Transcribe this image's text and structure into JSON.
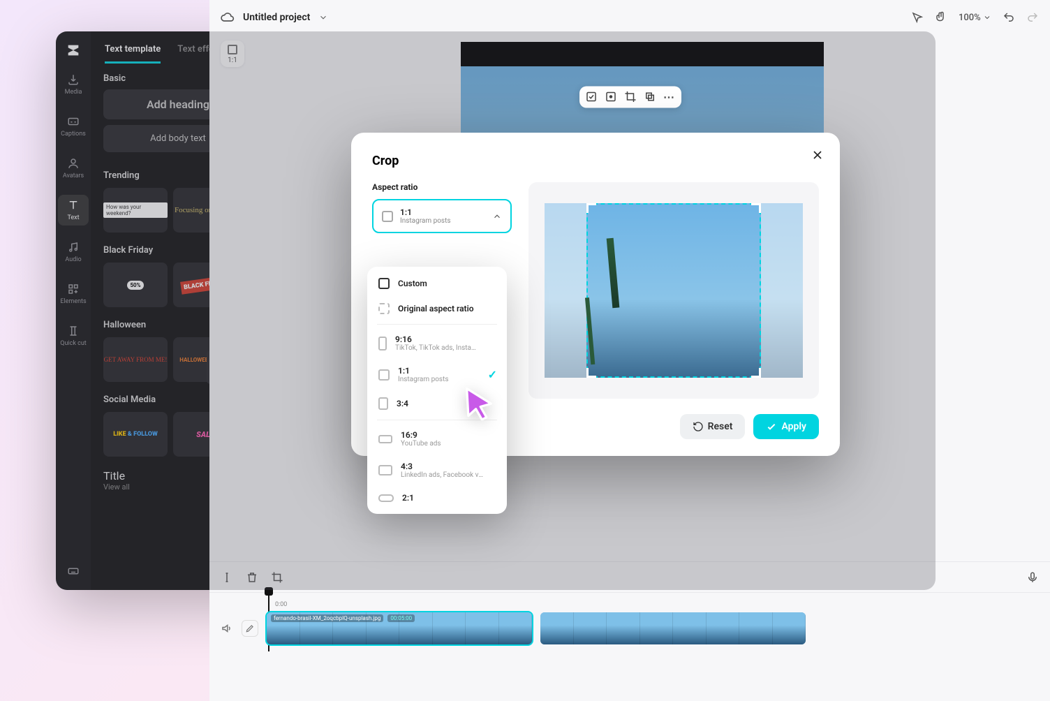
{
  "rail": {
    "items": [
      {
        "label": "Media"
      },
      {
        "label": "Captions"
      },
      {
        "label": "Avatars"
      },
      {
        "label": "Text"
      },
      {
        "label": "Audio"
      },
      {
        "label": "Elements"
      },
      {
        "label": "Quick cut"
      }
    ]
  },
  "tabs": {
    "template": "Text template",
    "effects": "Text effects"
  },
  "side": {
    "basic": "Basic",
    "add_heading": "Add heading",
    "add_body": "Add body text",
    "view_all": "View all",
    "sections": [
      "Trending",
      "Black Friday",
      "Halloween",
      "Social Media",
      "Title"
    ],
    "thumbs": {
      "trending": [
        "How was your weekend?",
        "Focusing on Myself"
      ],
      "black_friday": [
        "50%",
        "BLACK FRIDAY"
      ],
      "halloween": [
        "GET AWAY FROM ME!",
        "HALLOWEEN PARTY"
      ],
      "social": [
        "LIKE & FOLLOW",
        "SALE"
      ]
    }
  },
  "project": {
    "name": "Untitled project",
    "zoom": "100%",
    "ratio_chip": "1:1"
  },
  "timeline": {
    "time_start": "0:00",
    "clip_name": "fernando-brasil-XM_2oqcbpIQ-unsplash.jpg",
    "clip_duration": "00:05:00"
  },
  "modal": {
    "title": "Crop",
    "aspect_label": "Aspect ratio",
    "selected": {
      "ratio": "1:1",
      "desc": "Instagram posts"
    },
    "reset": "Reset",
    "apply": "Apply"
  },
  "dropdown": {
    "custom": "Custom",
    "original": "Original aspect ratio",
    "r916": {
      "t": "9:16",
      "d": "TikTok, TikTok ads, Instagr…"
    },
    "r11": {
      "t": "1:1",
      "d": "Instagram posts"
    },
    "r34": {
      "t": "3:4"
    },
    "r169": {
      "t": "16:9",
      "d": "YouTube ads"
    },
    "r43": {
      "t": "4:3",
      "d": "LinkedIn ads, Facebook vid…"
    },
    "r21": {
      "t": "2:1"
    }
  }
}
